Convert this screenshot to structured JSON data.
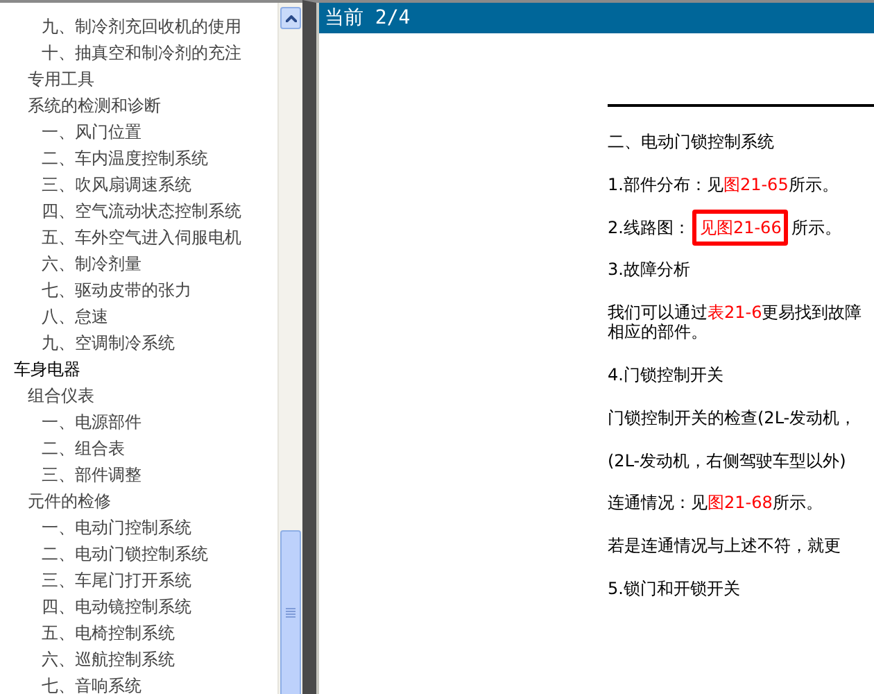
{
  "sidebar": {
    "tree": [
      {
        "children": [
          {
            "children": [
              {
                "label": "九、制冷剂充回收机的使用"
              },
              {
                "label": "十、抽真空和制冷剂的充注"
              }
            ]
          },
          {
            "label": "专用工具"
          },
          {
            "label": "系统的检测和诊断",
            "children": [
              {
                "label": "一、风门位置"
              },
              {
                "label": "二、车内温度控制系统"
              },
              {
                "label": "三、吹风扇调速系统"
              },
              {
                "label": "四、空气流动状态控制系统"
              },
              {
                "label": "五、车外空气进入伺服电机"
              },
              {
                "label": "六、制冷剂量"
              },
              {
                "label": "七、驱动皮带的张力"
              },
              {
                "label": "八、怠速"
              },
              {
                "label": "九、空调制冷系统"
              }
            ]
          }
        ]
      },
      {
        "label": "车身电器",
        "children": [
          {
            "label": "组合仪表",
            "children": [
              {
                "label": "一、电源部件"
              },
              {
                "label": "二、组合表"
              },
              {
                "label": "三、部件调整"
              }
            ]
          },
          {
            "label": "元件的检修",
            "children": [
              {
                "label": "一、电动门控制系统"
              },
              {
                "label": "二、电动门锁控制系统"
              },
              {
                "label": "三、车尾门打开系统"
              },
              {
                "label": "四、电动镜控制系统"
              },
              {
                "label": "五、电椅控制系统"
              },
              {
                "label": "六、巡航控制系统"
              },
              {
                "label": "七、音响系统"
              }
            ]
          }
        ]
      }
    ]
  },
  "viewer": {
    "title": "当前 2/4",
    "paragraphs": [
      [
        {
          "kind": "plain",
          "text": "二、电动门锁控制系统"
        }
      ],
      [
        {
          "kind": "plain",
          "text": "1.部件分布：见"
        },
        {
          "kind": "link",
          "text": "图21-65"
        },
        {
          "kind": "plain",
          "text": "所示。"
        }
      ],
      [
        {
          "kind": "plain",
          "text": "2.线路图："
        },
        {
          "kind": "link",
          "text": "见图21-66",
          "highlighted": true
        },
        {
          "kind": "plain",
          "text": "所示。"
        }
      ],
      [
        {
          "kind": "plain",
          "text": "3.故障分析"
        }
      ],
      [
        {
          "kind": "plain",
          "text": "我们可以通过"
        },
        {
          "kind": "link",
          "text": "表21-6"
        },
        {
          "kind": "plain",
          "text": "更易找到故障"
        },
        {
          "kind": "break"
        },
        {
          "kind": "plain",
          "text": "相应的部件。"
        }
      ],
      [
        {
          "kind": "plain",
          "text": "4.门锁控制开关"
        }
      ],
      [
        {
          "kind": "plain",
          "text": "门锁控制开关的检查(2L-发动机，"
        }
      ],
      [
        {
          "kind": "plain",
          "text": "(2L-发动机，右侧驾驶车型以外)"
        }
      ],
      [
        {
          "kind": "plain",
          "text": "连通情况：见"
        },
        {
          "kind": "link",
          "text": "图21-68"
        },
        {
          "kind": "plain",
          "text": "所示。"
        }
      ],
      [
        {
          "kind": "plain",
          "text": "若是连通情况与上述不符，就更"
        }
      ],
      [
        {
          "kind": "plain",
          "text": "5.锁门和开锁开关"
        }
      ]
    ]
  }
}
